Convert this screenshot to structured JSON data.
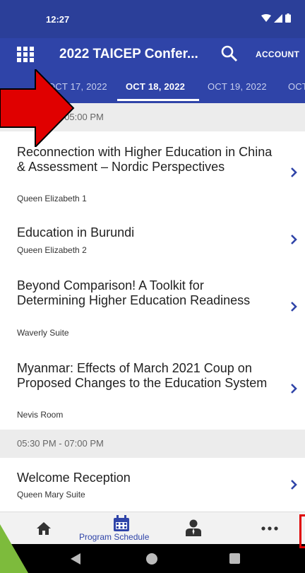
{
  "status_bar": {
    "time": "12:27"
  },
  "app_bar": {
    "title": "2022 TAICEP Confer...",
    "account_label": "ACCOUNT"
  },
  "date_tabs": [
    {
      "label": "OCT 17, 2022",
      "active": false
    },
    {
      "label": "OCT 18, 2022",
      "active": true
    },
    {
      "label": "OCT 19, 2022",
      "active": false
    },
    {
      "label": "OCT",
      "active": false
    }
  ],
  "schedule": {
    "sections": [
      {
        "time_range": "03:30 PM - 05:00 PM",
        "sessions": [
          {
            "title": "Reconnection with Higher Education in China & Assessment – Nordic Perspectives",
            "room": "Queen Elizabeth 1"
          },
          {
            "title": "Education in Burundi",
            "room": "Queen Elizabeth 2"
          },
          {
            "title": "Beyond Comparison! A Toolkit for Determining Higher Education Readiness",
            "room": "Waverly Suite"
          },
          {
            "title": "Myanmar: Effects of March 2021 Coup on Proposed Changes to the Education System",
            "room": "Nevis Room"
          }
        ]
      },
      {
        "time_range": "05:30 PM - 07:00 PM",
        "sessions": [
          {
            "title": "Welcome Reception",
            "room": "Queen Mary Suite"
          }
        ]
      }
    ]
  },
  "bottom_nav": {
    "active_label": "Program Schedule",
    "items": [
      "home-icon",
      "calendar-icon",
      "person-icon",
      "more-icon"
    ]
  },
  "colors": {
    "primary": "#2f44a8",
    "status_bar": "#2b3f99",
    "annotation_red": "#e00000"
  }
}
